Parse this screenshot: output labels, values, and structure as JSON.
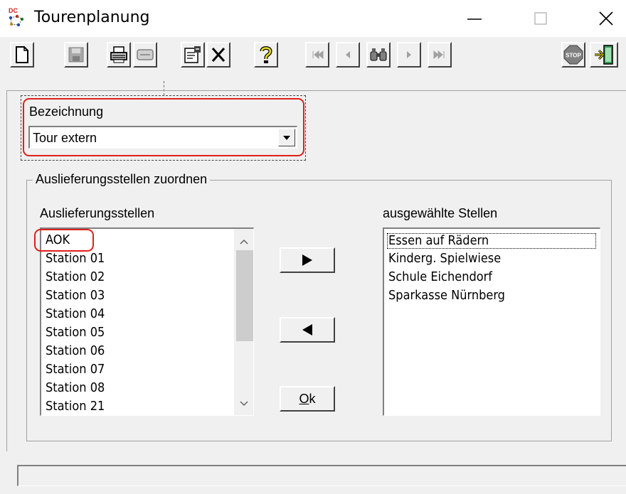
{
  "window": {
    "title": "Tourenplanung",
    "app_icon_text": "DC"
  },
  "toolbar": {
    "buttons": [
      "new-icon",
      "save-icon",
      "print-icon",
      "clear-icon",
      "properties-icon",
      "delete-icon",
      "help-icon",
      "first-icon",
      "previous-icon",
      "search-icon",
      "next-icon",
      "last-icon",
      "stop-icon",
      "exit-icon"
    ],
    "stop_label": "STOP"
  },
  "form": {
    "bezeichnung_label": "Bezeichnung",
    "bezeichnung_value": "Tour extern",
    "group_title": "Auslieferungsstellen zuordnen",
    "available_label": "Auslieferungsstellen",
    "selected_label": "ausgewählte Stellen",
    "available_items": [
      "AOK",
      "Station 01",
      "Station 02",
      "Station 03",
      "Station 04",
      "Station 05",
      "Station 06",
      "Station 07",
      "Station 08",
      "Station 21"
    ],
    "selected_items": [
      "Essen auf Rädern",
      "Kinderg. Spielwiese",
      "Schule Eichendorf",
      "Sparkasse Nürnberg"
    ],
    "ok_label": "Ok",
    "ok_hotkey": "O",
    "ok_rest": "k"
  },
  "colors": {
    "highlight": "#e0201a",
    "window_bg": "#f0f0f0"
  }
}
